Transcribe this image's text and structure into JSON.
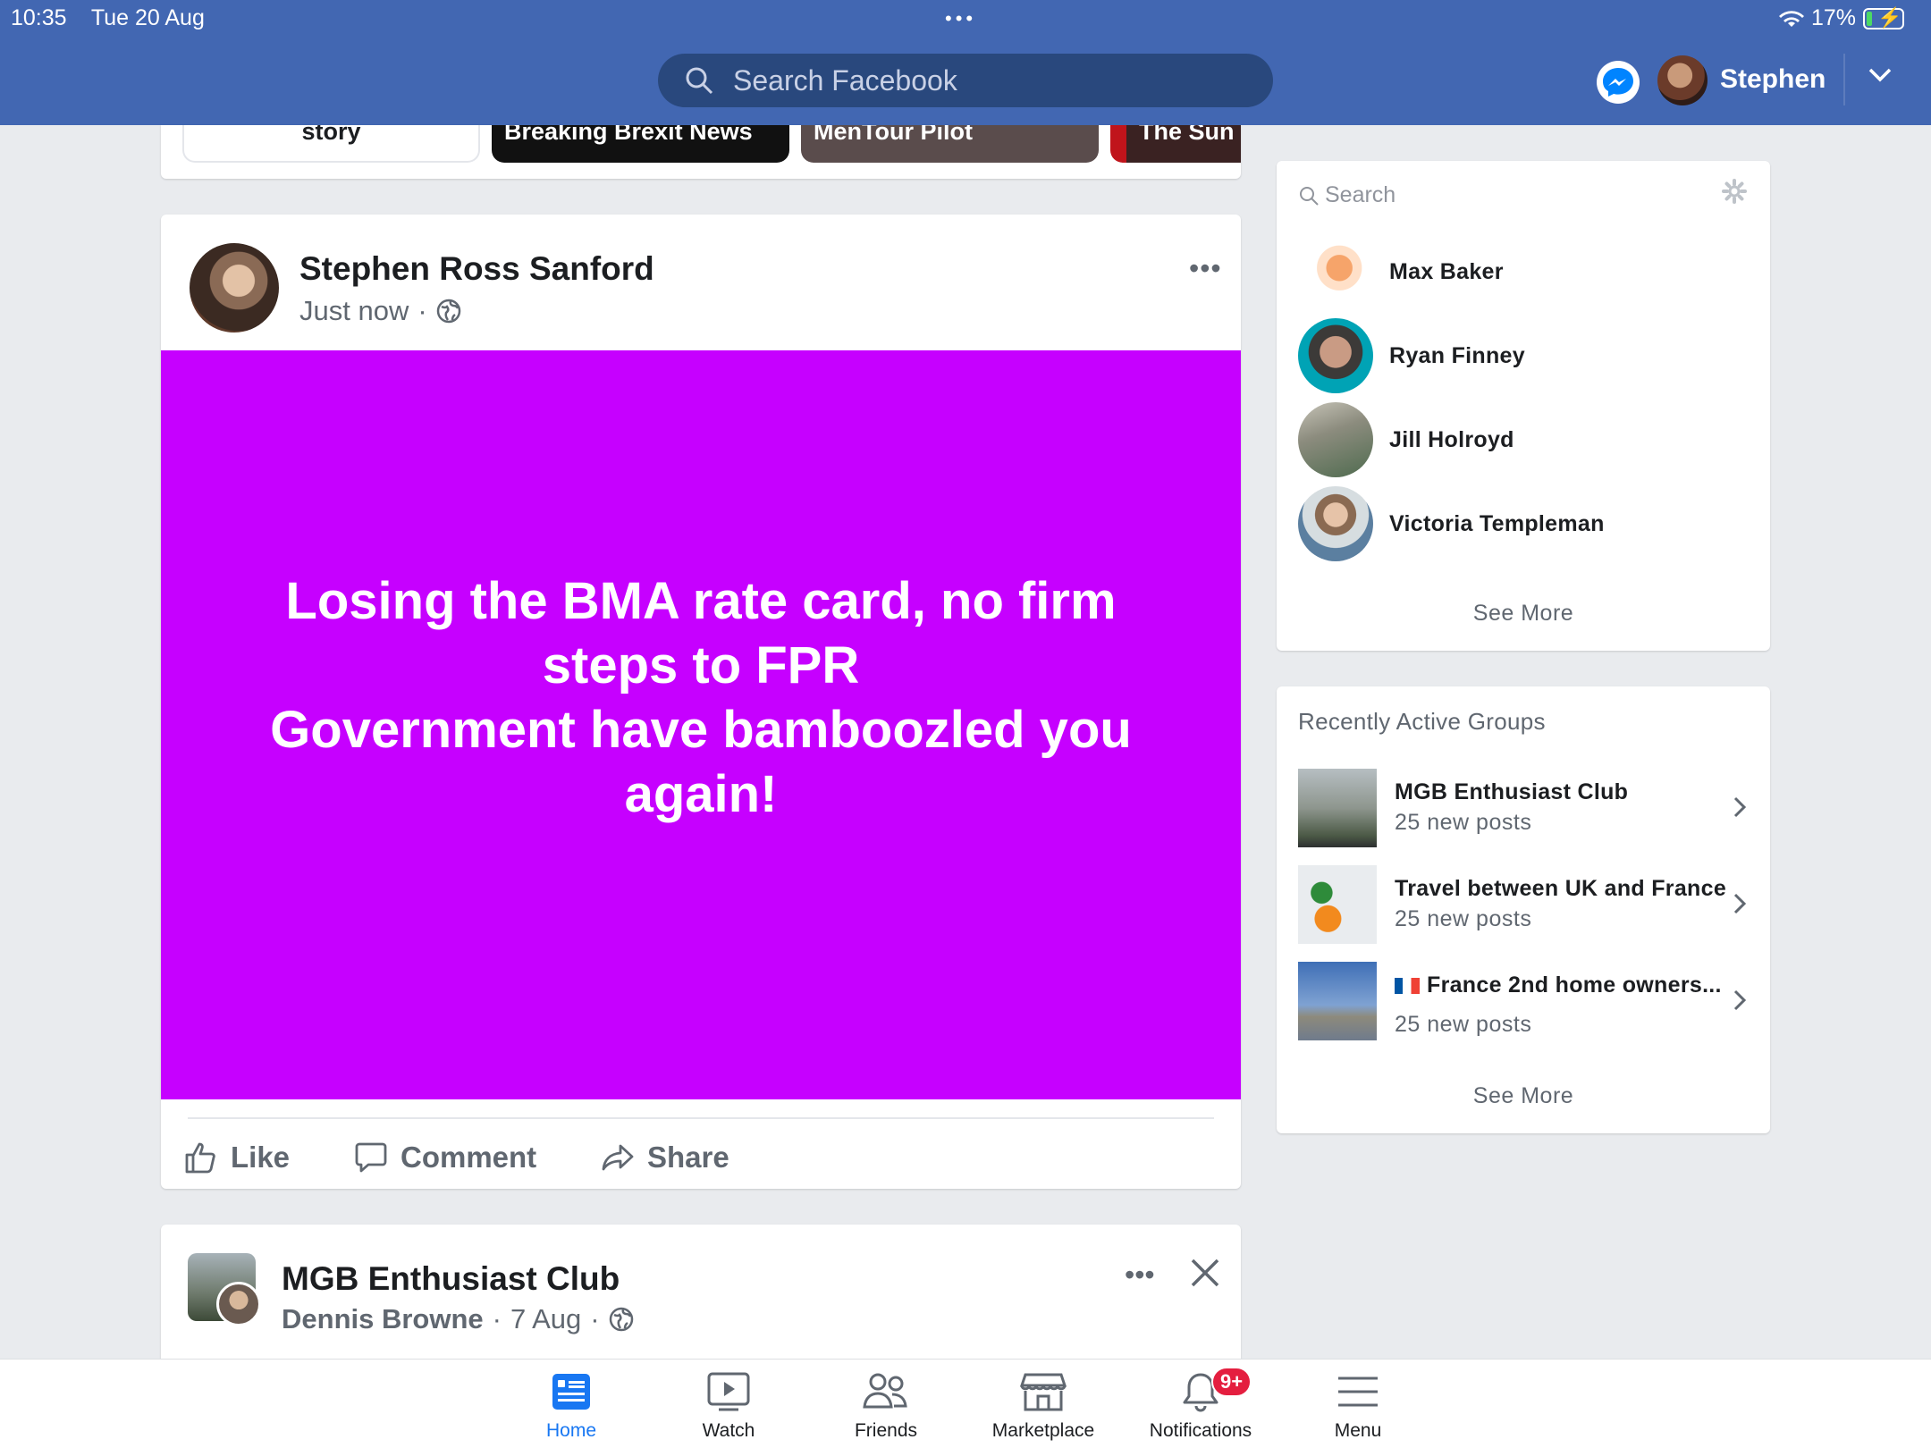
{
  "status_bar": {
    "time": "10:35",
    "date": "Tue 20 Aug",
    "battery": "17%",
    "battery_level": 0.17
  },
  "header": {
    "search_placeholder": "Search Facebook",
    "user_name": "Stephen"
  },
  "stories": [
    {
      "label": "story"
    },
    {
      "label": "Breaking Brexit News"
    },
    {
      "label": "MenTour Pilot"
    },
    {
      "label": "The Sun"
    }
  ],
  "post1": {
    "author": "Stephen Ross Sanford",
    "time": "Just now",
    "separator": "·",
    "text": "Losing the BMA rate card, no firm steps to FPR\nGovernment have bamboozled you again!",
    "background_color": "#c600ff",
    "actions": {
      "like": "Like",
      "comment": "Comment",
      "share": "Share"
    }
  },
  "post2": {
    "group": "MGB Enthusiast Club",
    "author": "Dennis Browne",
    "date": "7 Aug",
    "separator": "·"
  },
  "contacts": {
    "search_placeholder": "Search",
    "items": [
      {
        "name": "Max Baker"
      },
      {
        "name": "Ryan Finney"
      },
      {
        "name": "Jill Holroyd"
      },
      {
        "name": "Victoria Templeman"
      }
    ],
    "see_more": "See More"
  },
  "groups": {
    "title": "Recently Active Groups",
    "items": [
      {
        "name": "MGB Enthusiast Club",
        "sub": "25 new posts"
      },
      {
        "name": "Travel between UK and France",
        "sub": "25 new posts"
      },
      {
        "name": "France 2nd home owners...",
        "sub": "25 new posts"
      }
    ],
    "see_more": "See More"
  },
  "bottom_nav": {
    "tabs": [
      {
        "label": "Home"
      },
      {
        "label": "Watch"
      },
      {
        "label": "Friends"
      },
      {
        "label": "Marketplace"
      },
      {
        "label": "Notifications"
      },
      {
        "label": "Menu"
      }
    ],
    "notifications_badge": "9+"
  },
  "colors": {
    "brand": "#4267b2",
    "active_tab": "#1877f2",
    "badge": "#e41e3f"
  }
}
